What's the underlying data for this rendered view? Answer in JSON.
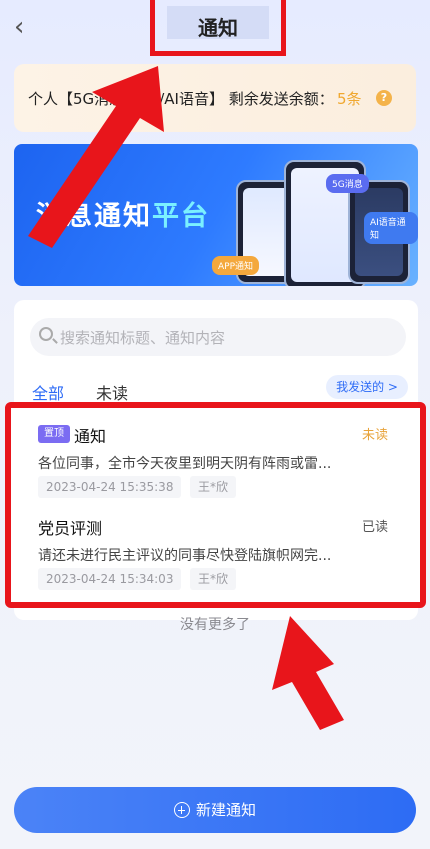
{
  "header": {
    "title": "通知",
    "back_glyph": "‹"
  },
  "quota": {
    "text": "个人【5G消息/短信/AI语音】 剩余发送余额：",
    "value": "5条",
    "help_glyph": "?"
  },
  "banner": {
    "title_main": "消息通知",
    "title_accent": "平台",
    "tags": {
      "five_g": "5G消息",
      "ai_voice": "AI语音通知",
      "app": "APP通知"
    }
  },
  "search": {
    "placeholder": "搜索通知标题、通知内容"
  },
  "tabs": {
    "all": "全部",
    "unread": "未读",
    "sent": "我发送的 >"
  },
  "notifications": [
    {
      "badge": "置顶",
      "title": "通知",
      "status": "未读",
      "desc": "各位同事，全市今天夜里到明天阴有阵雨或雷...",
      "time": "2023-04-24 15:35:38",
      "sender": "王*欣"
    },
    {
      "title": "党员评测",
      "status": "已读",
      "desc": "请还未进行民主评议的同事尽快登陆旗帜网完...",
      "time": "2023-04-24 15:34:03",
      "sender": "王*欣"
    }
  ],
  "footer": {
    "no_more": "没有更多了",
    "new_button": "新建通知"
  },
  "colors": {
    "accent_blue": "#2f6cf6",
    "highlight_red": "#e8151b",
    "unread_orange": "#e8a33a",
    "pin_purple": "#7b6cf2"
  }
}
